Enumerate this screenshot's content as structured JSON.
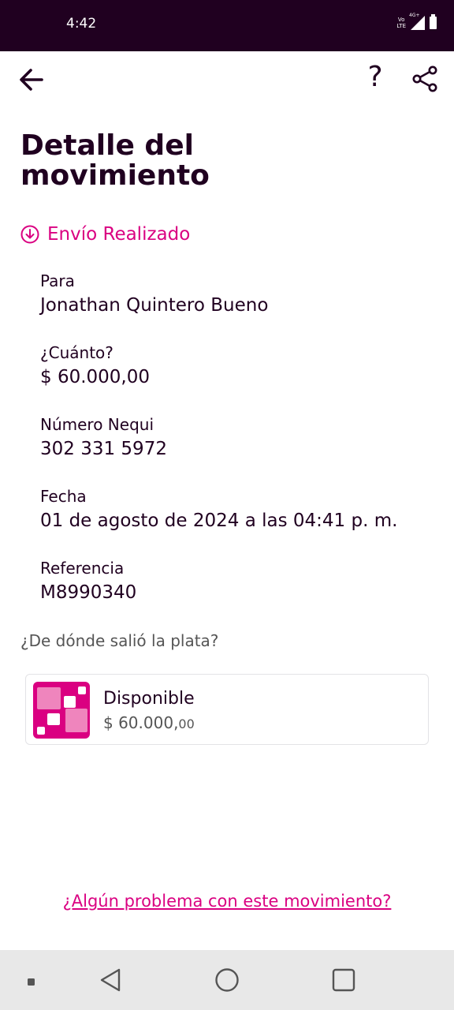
{
  "status_bar": {
    "time": "4:42",
    "volte_line1": "Vo",
    "volte_line2": "LTE",
    "network": "4G+"
  },
  "header": {
    "back_icon": "arrow-left-icon",
    "help_icon": "question-mark-icon",
    "help_glyph": "?",
    "share_icon": "share-icon"
  },
  "page": {
    "title_line1": "Detalle del",
    "title_line2": "movimiento"
  },
  "transaction": {
    "status_icon": "circle-arrow-down-icon",
    "status_label": "Envío Realizado",
    "fields": [
      {
        "label": "Para",
        "value": "Jonathan Quintero Bueno"
      },
      {
        "label": "¿Cuánto?",
        "value": "$ 60.000,00"
      },
      {
        "label": "Número Nequi",
        "value": "302 331 5972"
      },
      {
        "label": "Fecha",
        "value": "01 de agosto de 2024 a las 04:41 p. m."
      },
      {
        "label": "Referencia",
        "value": "M8990340"
      }
    ]
  },
  "source": {
    "question": "¿De dónde salió la plata?",
    "account_name": "Disponible",
    "balance_main": "$ 60.000,",
    "balance_cents": "00"
  },
  "footer": {
    "problem_link": "¿Algún problema con este movimiento?"
  },
  "colors": {
    "brand": "#da0081",
    "dark": "#200020"
  }
}
